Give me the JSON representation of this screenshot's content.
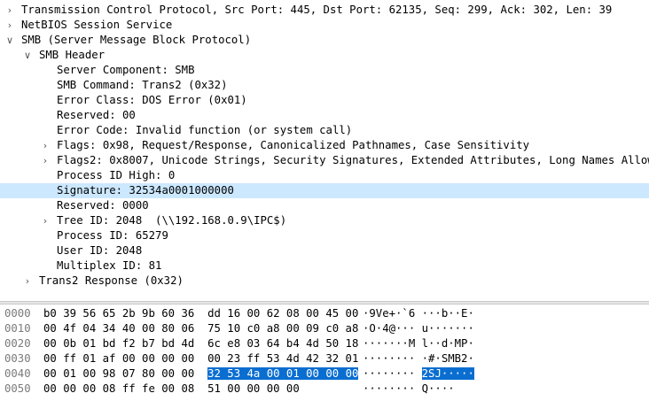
{
  "tree": [
    {
      "id": "tcp",
      "indent": 0,
      "expander": "right",
      "label": "Transmission Control Protocol, Src Port: 445, Dst Port: 62135, Seq: 299, Ack: 302, Len: 39"
    },
    {
      "id": "netbios",
      "indent": 0,
      "expander": "right",
      "label": "NetBIOS Session Service"
    },
    {
      "id": "smb",
      "indent": 0,
      "expander": "down",
      "label": "SMB (Server Message Block Protocol)"
    },
    {
      "id": "smb-header",
      "indent": 1,
      "expander": "down",
      "label": "SMB Header"
    },
    {
      "id": "server-component",
      "indent": 2,
      "expander": "",
      "label": "Server Component: SMB"
    },
    {
      "id": "smb-command",
      "indent": 2,
      "expander": "",
      "label": "SMB Command: Trans2 (0x32)"
    },
    {
      "id": "error-class",
      "indent": 2,
      "expander": "",
      "label": "Error Class: DOS Error (0x01)"
    },
    {
      "id": "reserved-1",
      "indent": 2,
      "expander": "",
      "label": "Reserved: 00"
    },
    {
      "id": "error-code",
      "indent": 2,
      "expander": "",
      "label": "Error Code: Invalid function (or system call)"
    },
    {
      "id": "flags",
      "indent": 2,
      "expander": "right",
      "label": "Flags: 0x98, Request/Response, Canonicalized Pathnames, Case Sensitivity"
    },
    {
      "id": "flags2",
      "indent": 2,
      "expander": "right",
      "label": "Flags2: 0x8007, Unicode Strings, Security Signatures, Extended Attributes, Long Names Allowed"
    },
    {
      "id": "process-id-high",
      "indent": 2,
      "expander": "",
      "label": "Process ID High: 0"
    },
    {
      "id": "signature",
      "indent": 2,
      "expander": "",
      "label": "Signature: 32534a0001000000",
      "selected": true
    },
    {
      "id": "reserved-2",
      "indent": 2,
      "expander": "",
      "label": "Reserved: 0000"
    },
    {
      "id": "tree-id",
      "indent": 2,
      "expander": "right",
      "label": "Tree ID: 2048  (\\\\192.168.0.9\\IPC$)"
    },
    {
      "id": "process-id",
      "indent": 2,
      "expander": "",
      "label": "Process ID: 65279"
    },
    {
      "id": "user-id",
      "indent": 2,
      "expander": "",
      "label": "User ID: 2048"
    },
    {
      "id": "multiplex-id",
      "indent": 2,
      "expander": "",
      "label": "Multiplex ID: 81"
    },
    {
      "id": "trans2-response",
      "indent": 1,
      "expander": "right",
      "label": "Trans2 Response (0x32)"
    }
  ],
  "bytes": [
    {
      "offset": "0000",
      "hex": "b0 39 56 65 2b 9b 60 36  dd 16 00 62 08 00 45 00",
      "ascii": "·9Ve+·`6 ···b··E·"
    },
    {
      "offset": "0010",
      "hex": "00 4f 04 34 40 00 80 06  75 10 c0 a8 00 09 c0 a8",
      "ascii": "·O·4@··· u·······"
    },
    {
      "offset": "0020",
      "hex": "00 0b 01 bd f2 b7 bd 4d  6c e8 03 64 b4 4d 50 18",
      "ascii": "·······M l··d·MP·"
    },
    {
      "offset": "0030",
      "hex": "00 ff 01 af 00 00 00 00  00 23 ff 53 4d 42 32 01",
      "ascii": "········ ·#·SMB2·"
    },
    {
      "offset": "0040",
      "hex_pre": "00 01 00 98 07 80 00 00  ",
      "hex_sel": "32 53 4a 00 01 00 00 00",
      "ascii_pre": "········ ",
      "ascii_sel": "2SJ·····"
    },
    {
      "offset": "0050",
      "hex": "00 00 00 08 ff fe 00 08  51 00 00 00 00",
      "ascii": "········ Q····"
    }
  ],
  "colors": {
    "selected_row": "#cce8ff",
    "selected_bytes": "#0a6ed1"
  }
}
